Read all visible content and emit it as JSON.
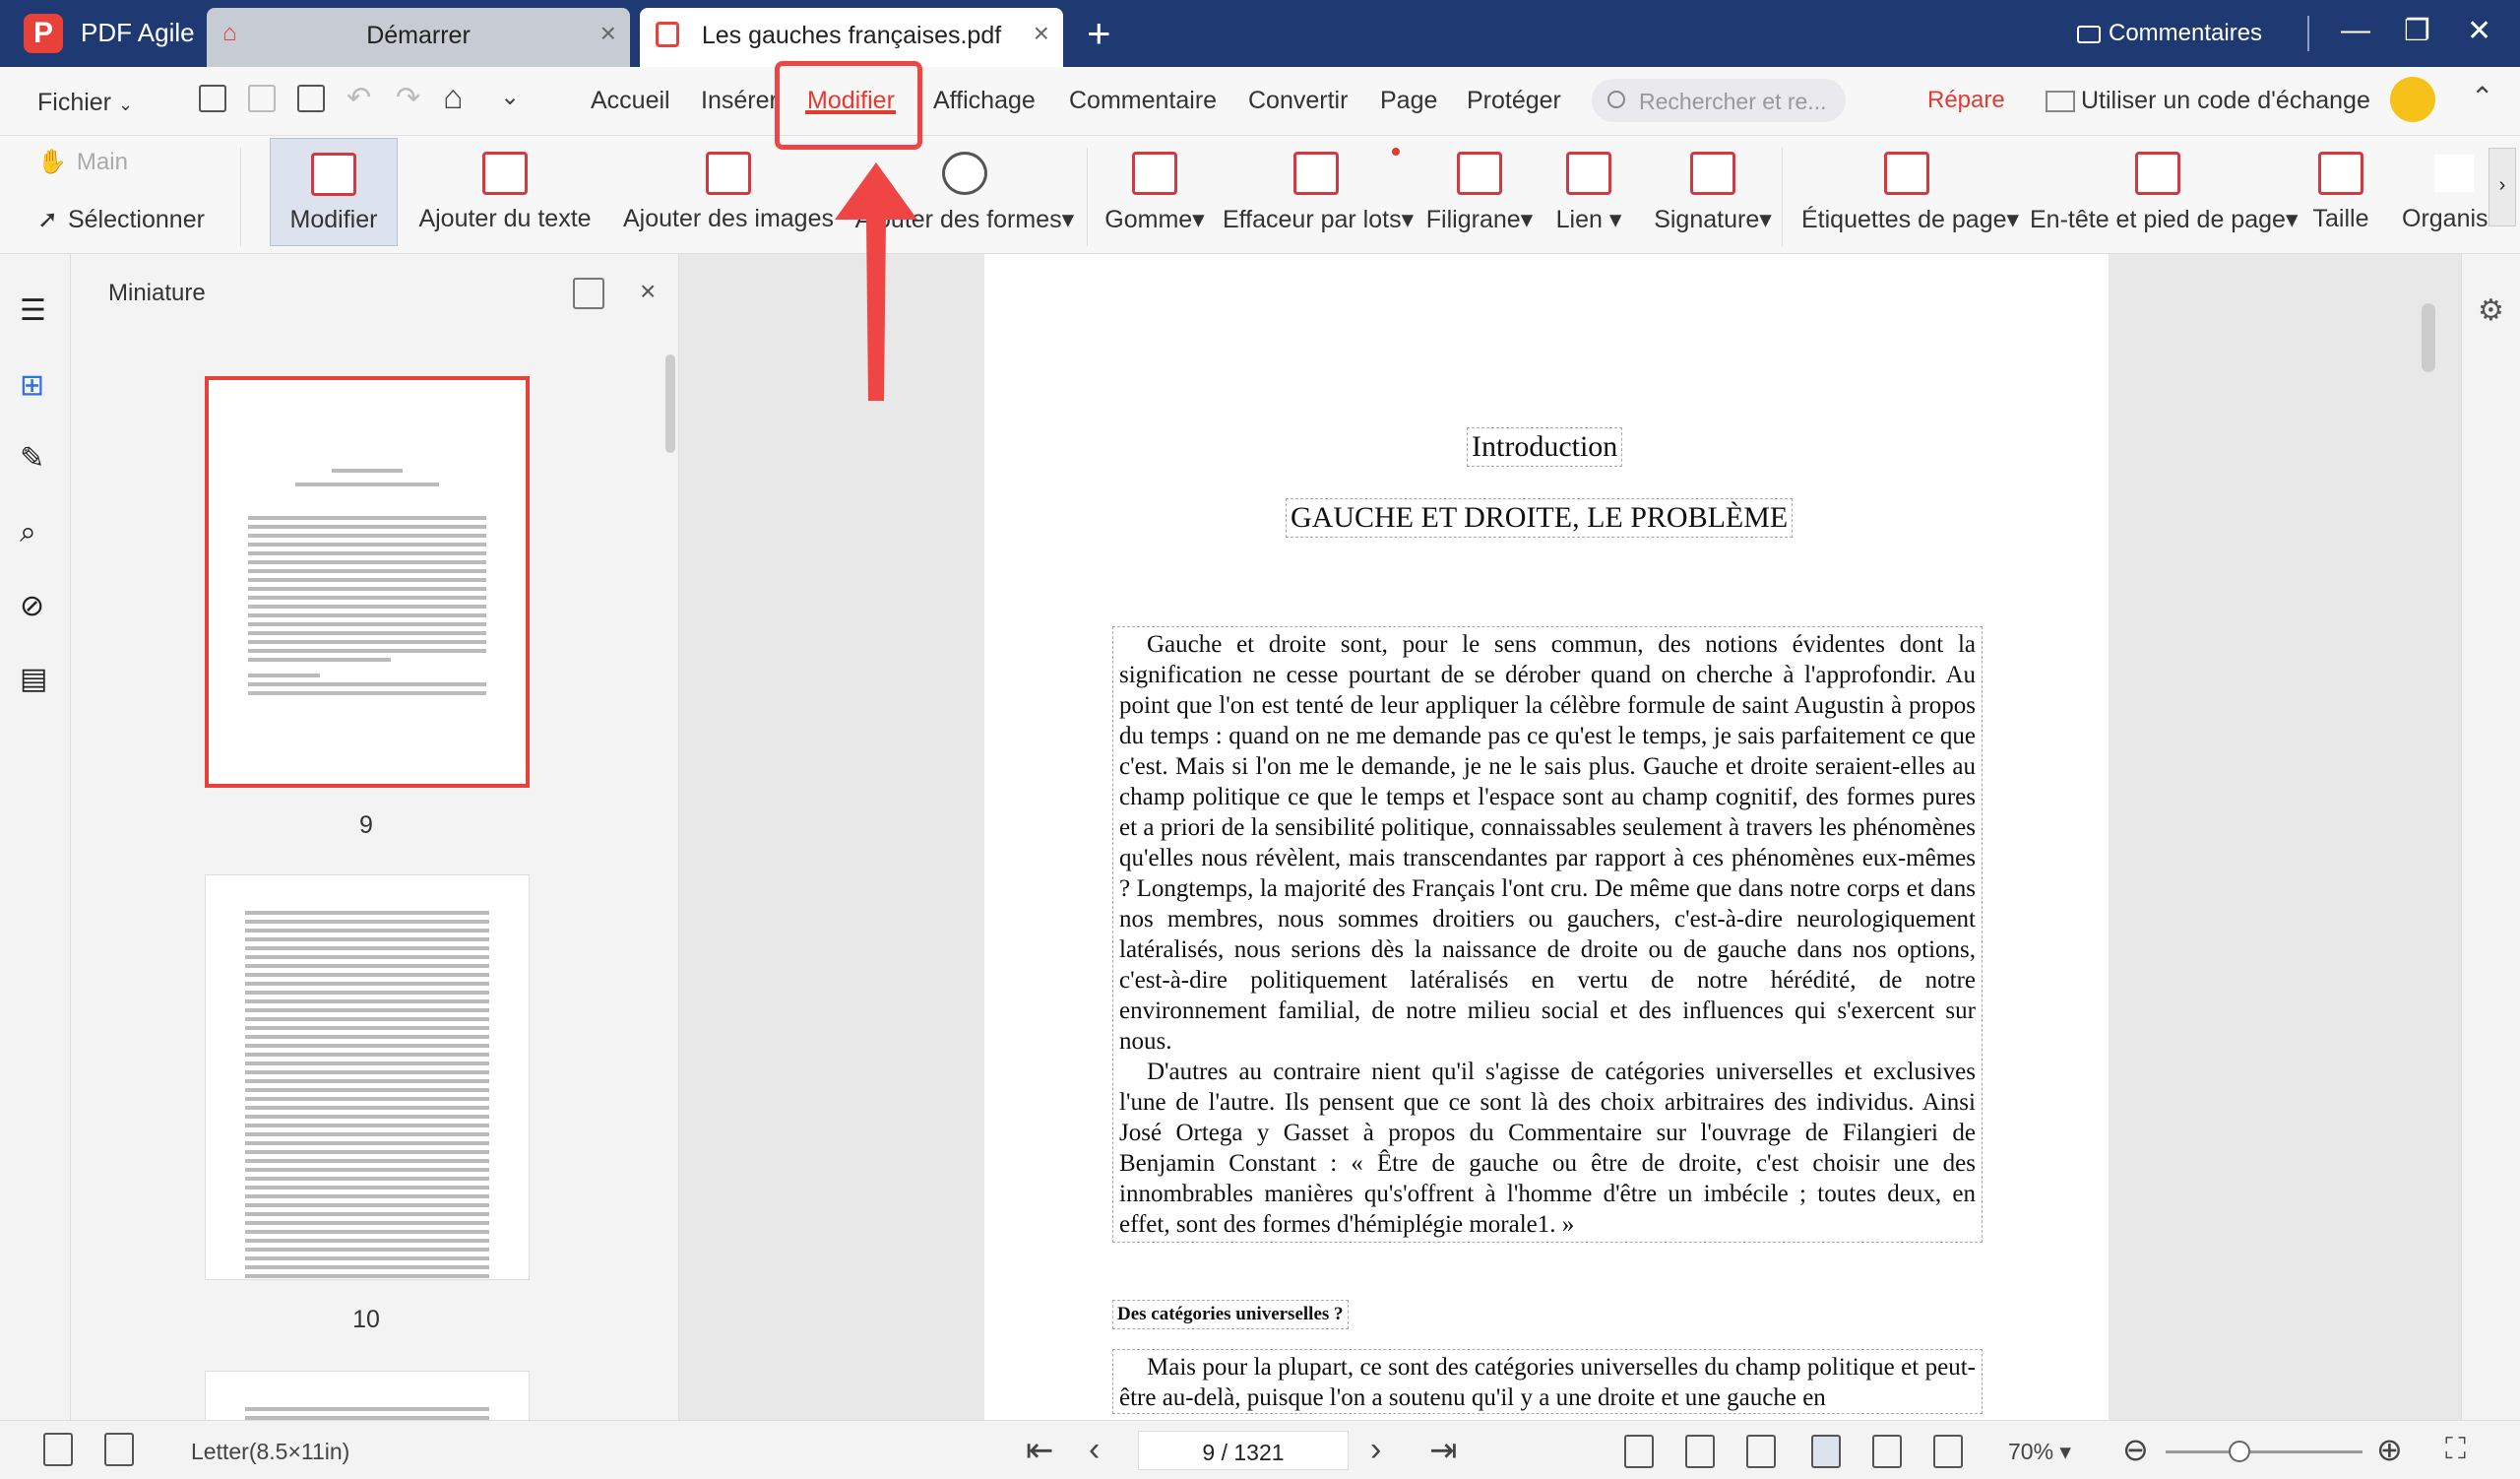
{
  "app": {
    "name": "PDF Agile"
  },
  "tabs": [
    {
      "label": "Démarrer"
    },
    {
      "label": "Les gauches françaises.pdf"
    }
  ],
  "titlebar": {
    "comments_label": "Commentaires"
  },
  "menubar": {
    "file": "Fichier",
    "items": [
      "Accueil",
      "Insérer",
      "Modifier",
      "Affichage",
      "Commentaire",
      "Convertir",
      "Page",
      "Protéger"
    ],
    "active": "Modifier",
    "search_placeholder": "Rechercher et re...",
    "repare": "Répare",
    "exchange_code": "Utiliser un code d'échange"
  },
  "ribbon": {
    "hand": "Main",
    "select": "Sélectionner",
    "tools": [
      "Modifier",
      "Ajouter du texte",
      "Ajouter des images",
      "Ajouter des formes",
      "Gomme",
      "Effaceur par lots",
      "Filigrane",
      "Lien",
      "Signature",
      "Étiquettes de page",
      "En-tête et pied de page",
      "Taille",
      "Organis"
    ]
  },
  "thumbnails": {
    "title": "Miniature",
    "pages": [
      "9",
      "10"
    ]
  },
  "document": {
    "title": "Introduction",
    "subtitle": "GAUCHE ET DROITE, LE PROBLÈME",
    "p1": "Gauche et droite sont, pour le sens commun, des notions évidentes dont la signification ne cesse pourtant de se dérober quand on cherche à l'approfondir. Au point que l'on est tenté de leur appliquer la célèbre formule de saint Augustin à propos du temps : quand on ne me demande pas ce qu'est le temps, je sais parfaitement ce que c'est. Mais si l'on me le demande, je ne le sais plus. Gauche et droite seraient-elles au champ politique ce que le temps et l'espace sont au champ cognitif, des formes pures et a priori de la sensibilité politique, connaissables seulement à travers les phénomènes qu'elles nous révèlent, mais transcendantes par rapport à ces phénomènes eux-mêmes ? Longtemps, la majorité des Français l'ont cru. De même que dans notre corps et dans nos membres, nous sommes droitiers ou gauchers, c'est-à-dire neurologiquement latéralisés, nous serions dès la naissance de droite ou de gauche dans nos options, c'est-à-dire politiquement latéralisés en vertu de notre hérédité, de notre environnement familial, de notre milieu social et des influences qui s'exercent sur nous.",
    "p2": "D'autres au contraire nient qu'il s'agisse de catégories universelles et exclusives l'une de l'autre. Ils pensent que ce sont là des choix arbitraires des individus. Ainsi José Ortega y Gasset à propos du Commentaire sur l'ouvrage de Filangieri de Benjamin Constant : « Être de gauche ou être de droite, c'est choisir une des innombrables manières qu's'offrent à l'homme d'être un imbécile ; toutes deux, en effet, sont des formes d'hémiplégie morale1. »",
    "heading": "Des catégories universelles ?",
    "p3": "Mais pour la plupart, ce sont des catégories universelles du champ politique et peut-être au-delà, puisque l'on a soutenu qu'il y a une droite et une gauche en"
  },
  "status": {
    "page_size": "Letter(8.5×11in)",
    "page_indicator": "9 / 1321",
    "zoom": "70%"
  },
  "colors": {
    "titlebar": "#1f3a73",
    "accent": "#e23b30"
  }
}
